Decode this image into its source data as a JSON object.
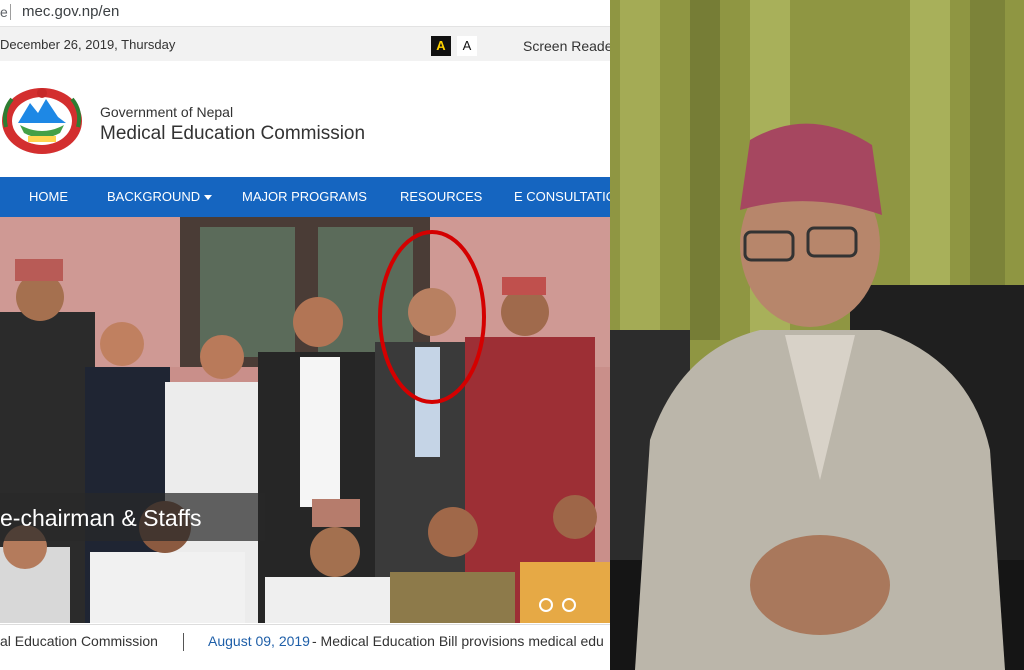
{
  "browser": {
    "url_partial_left": "e",
    "url": "mec.gov.np/en"
  },
  "topbar": {
    "date": "December 26, 2019, Thursday",
    "font_btn_dark": "A",
    "font_btn_light": "A",
    "screen_reader": "Screen Reade"
  },
  "header": {
    "line1": "Government of Nepal",
    "line2": "Medical Education Commission"
  },
  "nav": {
    "items": [
      "HOME",
      "BACKGROUND",
      "MAJOR PROGRAMS",
      "RESOURCES",
      "E CONSULTATIO"
    ]
  },
  "slider": {
    "caption": "e-chairman & Staffs",
    "highlight_color": "#d40000"
  },
  "ticker": {
    "left_text": "al Education Commission",
    "date": "August 09, 2019",
    "headline": "- Medical Education Bill provisions medical edu"
  },
  "colors": {
    "nav_bg": "#1565c0",
    "topbar_bg": "#f2f2f2",
    "link": "#1f5fa8"
  }
}
